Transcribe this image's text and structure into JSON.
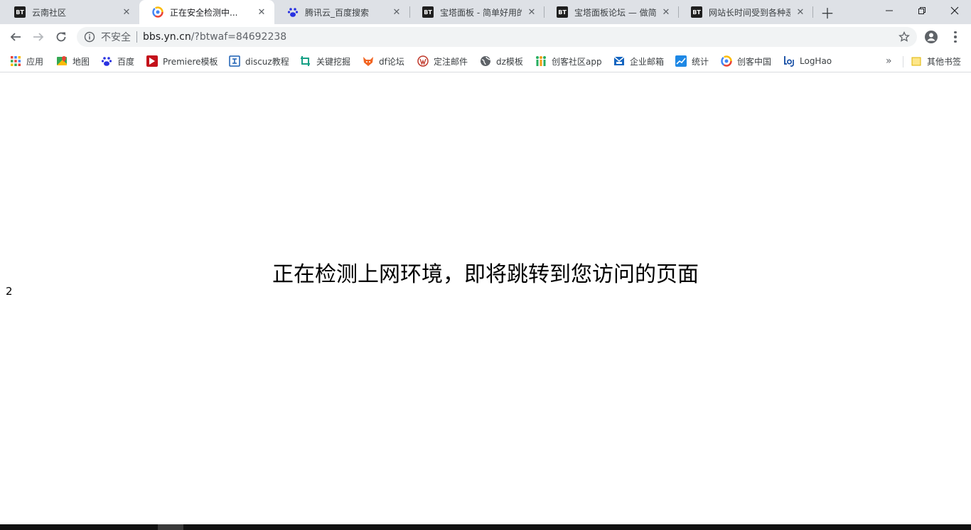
{
  "tabs": [
    {
      "title": "云南社区",
      "favicon": "bt-icon"
    },
    {
      "title": "正在安全检测中...",
      "favicon": "chrome-colored-icon"
    },
    {
      "title": "腾讯云_百度搜索",
      "favicon": "baidu-paw-icon"
    },
    {
      "title": "宝塔面板 - 简单好用的L",
      "favicon": "bt-icon"
    },
    {
      "title": "宝塔面板论坛 — 做简单",
      "favicon": "bt-icon"
    },
    {
      "title": "网站长时间受到各种恶意",
      "favicon": "bt-icon"
    }
  ],
  "bt_text": "BT",
  "toolbar": {
    "security_label": "不安全",
    "url_host": "bbs.yn.cn",
    "url_path": "/?btwaf=84692238"
  },
  "bookmarks": [
    {
      "label": "应用",
      "icon": "apps-grid-icon"
    },
    {
      "label": "地图",
      "icon": "maps-pin-icon"
    },
    {
      "label": "百度",
      "icon": "baidu-paw-icon"
    },
    {
      "label": "Premiere模板",
      "icon": "premiere-icon"
    },
    {
      "label": "discuz教程",
      "icon": "discuz-icon"
    },
    {
      "label": "关键挖掘",
      "icon": "keyword-icon"
    },
    {
      "label": "df论坛",
      "icon": "fox-icon"
    },
    {
      "label": "定注邮件",
      "icon": "wordpress-icon"
    },
    {
      "label": "dz模板",
      "icon": "globe-icon"
    },
    {
      "label": "创客社区app",
      "icon": "community-icon"
    },
    {
      "label": "企业邮箱",
      "icon": "mail-icon"
    },
    {
      "label": "统计",
      "icon": "chart-icon"
    },
    {
      "label": "创客中国",
      "icon": "chrome-colored-icon"
    },
    {
      "label": "LogHao",
      "icon": "loghao-icon"
    }
  ],
  "other_bookmarks": "其他书签",
  "page": {
    "message": "正在检测上网环境，即将跳转到您访问的页面",
    "countdown": "2"
  }
}
